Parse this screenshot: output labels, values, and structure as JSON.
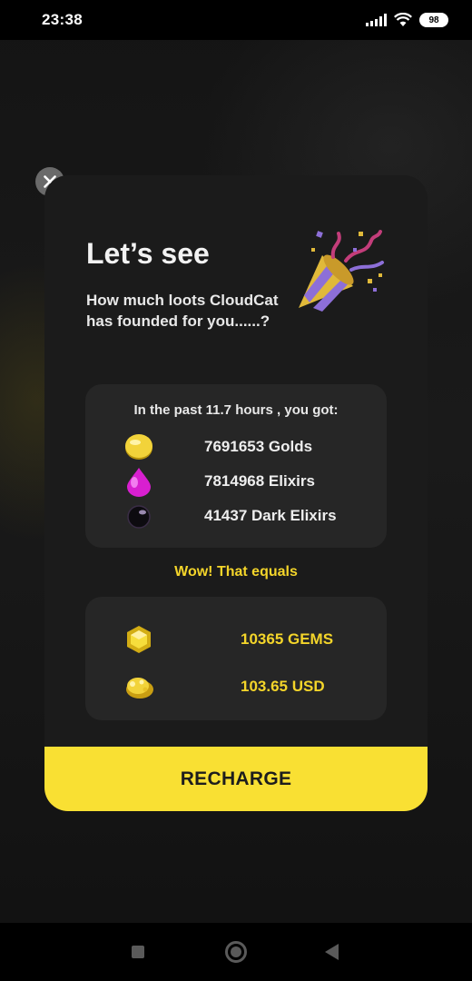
{
  "status_bar": {
    "time": "23:38",
    "battery": "98",
    "icons": [
      "signal-icon",
      "wifi-icon",
      "battery-icon"
    ]
  },
  "dialog": {
    "close_icon": "close-icon",
    "title": "Let’s see",
    "subtitle": "How much loots CloudCat has founded for you......?",
    "illustration": "party-popper-icon",
    "loot_header": "In the past 11.7  hours , you got:",
    "loot": [
      {
        "icon": "gold-coin-icon",
        "text": "7691653 Golds"
      },
      {
        "icon": "elixir-drop-icon",
        "text": "7814968 Elixirs"
      },
      {
        "icon": "dark-elixir-icon",
        "text": "41437 Dark Elixirs"
      }
    ],
    "equals_label": "Wow! That equals",
    "conversions": [
      {
        "icon": "gem-icon",
        "text": "10365 GEMS"
      },
      {
        "icon": "gold-pile-icon",
        "text": "103.65 USD"
      }
    ],
    "recharge_label": "RECHARGE"
  },
  "colors": {
    "accent": "#f9e033",
    "accent_text": "#f4d52a",
    "card_bg": "#1b1b1b",
    "box_bg": "#262626"
  },
  "nav_bar": {
    "icons": [
      "recents-icon",
      "home-icon",
      "back-icon"
    ]
  }
}
